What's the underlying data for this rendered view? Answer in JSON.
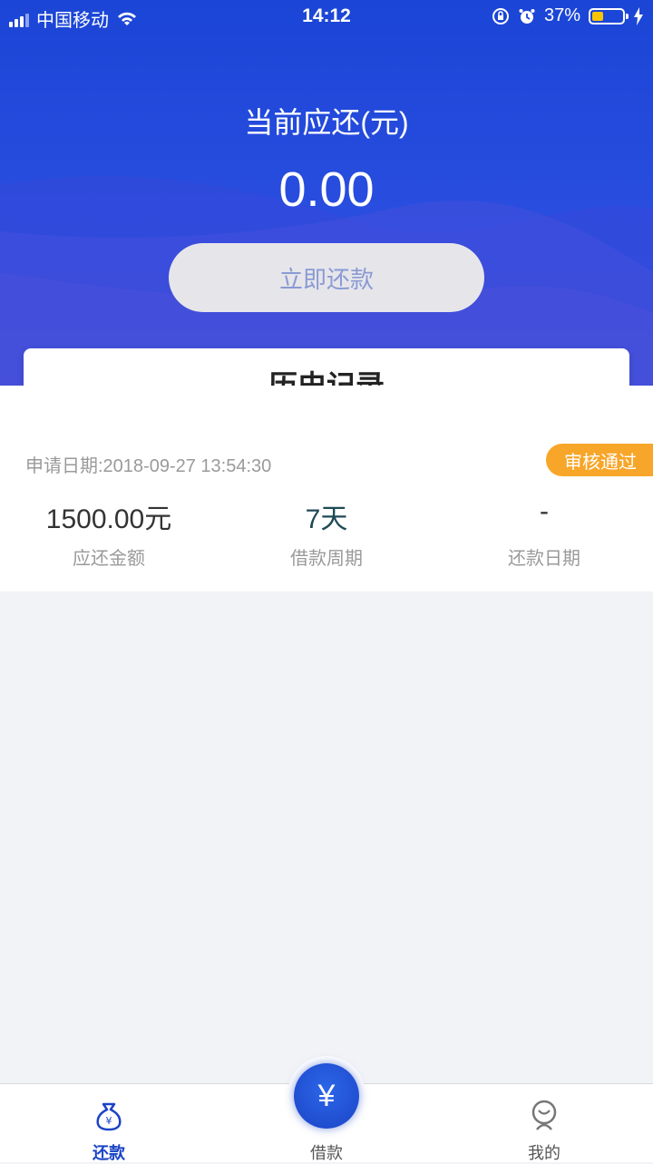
{
  "status_bar": {
    "carrier": "中国移动",
    "time": "14:12",
    "battery": "37%"
  },
  "hero": {
    "title": "当前应还(元)",
    "amount": "0.00",
    "button": "立即还款"
  },
  "history": {
    "title": "历史记录"
  },
  "record": {
    "date_label": "申请日期:2018-09-27 13:54:30",
    "status": "审核通过",
    "columns": [
      {
        "value": "1500.00元",
        "label": "应还金额"
      },
      {
        "value": "7天",
        "label": "借款周期"
      },
      {
        "value": "-",
        "label": "还款日期"
      }
    ]
  },
  "tabbar": {
    "tabs": [
      {
        "label": "还款",
        "icon": "money-bag-icon",
        "active": true
      },
      {
        "label": "借款",
        "icon": "yen-icon",
        "active": false
      },
      {
        "label": "我的",
        "icon": "person-icon",
        "active": false
      }
    ]
  },
  "colors": {
    "primary": "#1b45d6",
    "badge": "#f7a629",
    "active_tab": "#1b44c6",
    "inactive_tab": "#555555"
  }
}
